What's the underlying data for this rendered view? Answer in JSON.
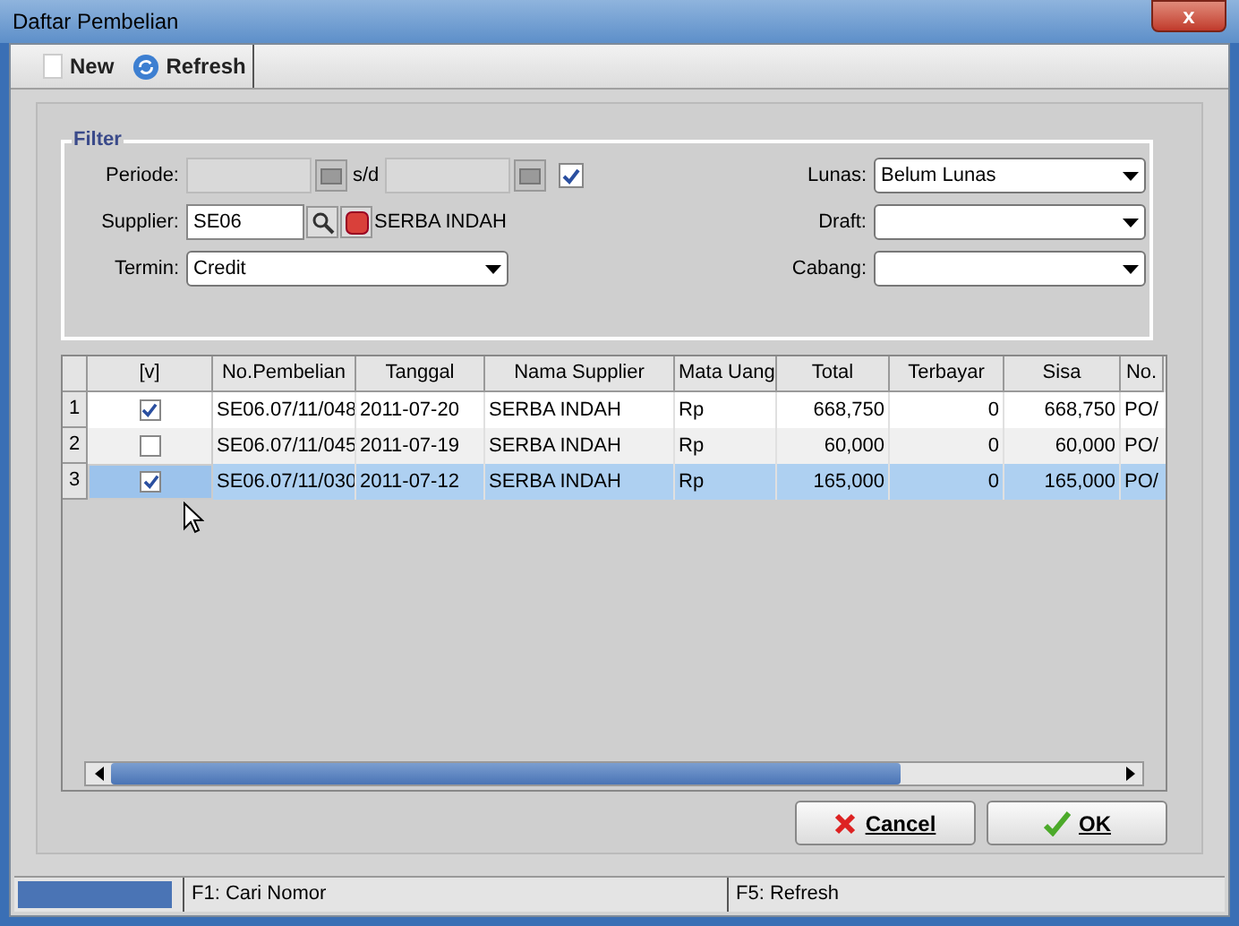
{
  "window": {
    "title": "Daftar Pembelian",
    "close": "x"
  },
  "toolbar": [
    {
      "label": "New",
      "kind": "new"
    },
    {
      "label": "Refresh",
      "kind": "refresh"
    }
  ],
  "filter": {
    "title": "Filter",
    "periode": {
      "label": "Periode:",
      "separator": "s/d",
      "checked": true
    },
    "supplier": {
      "label": "Supplier:",
      "value": "SE06",
      "name": "SERBA INDAH"
    },
    "termin": {
      "label": "Termin:",
      "value": "Credit"
    },
    "lunas": {
      "label": "Lunas:",
      "value": "Belum Lunas"
    },
    "draft": {
      "label": "Draft:"
    },
    "cabang": {
      "label": "Cabang:"
    }
  },
  "table": {
    "check_column": "[v]",
    "columns": [
      "No.Pembelian",
      "Tanggal",
      "Nama Supplier",
      "Mata Uang",
      "Total",
      "Terbayar",
      "Sisa",
      "No."
    ],
    "rows": [
      {
        "number": "1",
        "checked": true,
        "selected": false,
        "cells": [
          "SE06.07/11/048",
          "2011-07-20",
          "SERBA INDAH",
          "Rp",
          "668,750",
          "0",
          "668,750",
          "PO/"
        ]
      },
      {
        "number": "2",
        "checked": false,
        "selected": false,
        "cells": [
          "SE06.07/11/045",
          "2011-07-19",
          "SERBA INDAH",
          "Rp",
          "60,000",
          "0",
          "60,000",
          "PO/"
        ]
      },
      {
        "number": "3",
        "checked": true,
        "selected": true,
        "cells": [
          "SE06.07/11/030",
          "2011-07-12",
          "SERBA INDAH",
          "Rp",
          "165,000",
          "0",
          "165,000",
          "PO/"
        ]
      }
    ]
  },
  "buttons": [
    {
      "label": "Cancel",
      "kind": "cancel"
    },
    {
      "label": "OK",
      "kind": "ok"
    }
  ],
  "progress": {
    "level": 1
  },
  "status_bar": [
    "F1: Cari Nomor",
    "F5: Refresh"
  ]
}
